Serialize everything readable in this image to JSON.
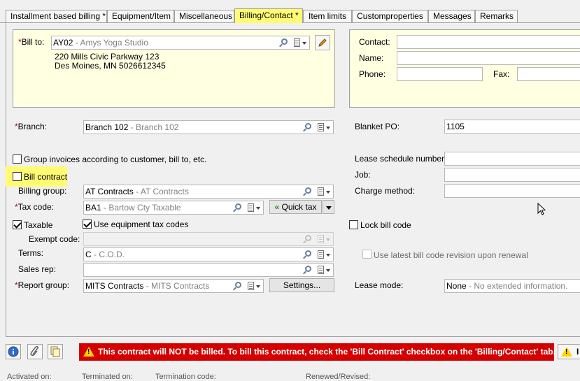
{
  "tabs": [
    {
      "label": "Installment based billing *",
      "active": false
    },
    {
      "label": "Equipment/Item",
      "active": false
    },
    {
      "label": "Miscellaneous",
      "active": false
    },
    {
      "label": "Billing/Contact *",
      "active": true
    },
    {
      "label": "Item limits",
      "active": false
    },
    {
      "label": "Customproperties",
      "active": false
    },
    {
      "label": "Messages",
      "active": false
    },
    {
      "label": "Remarks",
      "active": false
    }
  ],
  "bill_to": {
    "label": "Bill to:",
    "code": "AY02",
    "name": " - Amys Yoga Studio",
    "address_line1": "220 Mills Civic Parkway 123",
    "address_line2": "Des Moines, MN 5026612345"
  },
  "contact": {
    "contact_label": "Contact:",
    "name_label": "Name:",
    "phone_label": "Phone:",
    "fax_label": "Fax:"
  },
  "branch": {
    "label": "Branch:",
    "code": "Branch 102",
    "desc": " - Branch 102"
  },
  "blanket_po": {
    "label": "Blanket PO:",
    "value": "1105"
  },
  "group_invoices": {
    "label": "Group invoices according to customer, bill to, etc.",
    "checked": false
  },
  "bill_contract": {
    "label": "Bill contract",
    "checked": false
  },
  "lease_schedule": {
    "label": "Lease schedule number:"
  },
  "job": {
    "label": "Job:"
  },
  "charge_method": {
    "label": "Charge method:"
  },
  "billing_group": {
    "label": "Billing group:",
    "code": "AT Contracts",
    "desc": " - AT Contracts"
  },
  "tax_code": {
    "label": "Tax code:",
    "code": "BA1",
    "desc": " - Bartow Cty Taxable",
    "quick_tax_label": "Quick tax"
  },
  "taxable": {
    "label": "Taxable",
    "checked": true
  },
  "use_equipment_tax": {
    "label": "Use equipment tax codes",
    "checked": true
  },
  "lock_bill_code": {
    "label": "Lock bill code",
    "checked": false
  },
  "exempt_code": {
    "label": "Exempt code:"
  },
  "terms": {
    "label": "Terms:",
    "code": "C",
    "desc": " - C.O.D."
  },
  "latest_bill_code": {
    "label": "Use latest bill code revision upon renewal",
    "checked": false
  },
  "sales_rep": {
    "label": "Sales rep:"
  },
  "report_group": {
    "label": "Report group:",
    "code": "MITS Contracts",
    "desc": " - MITS Contracts",
    "settings_label": "Settings..."
  },
  "lease_mode": {
    "label": "Lease mode:",
    "code": "None",
    "desc": " - No extended information."
  },
  "banner": {
    "message": "This contract will NOT be billed.  To bill this contract, check the 'Bill Contract' checkbox on the 'Billing/Contact' tab.",
    "color": "#d40000"
  },
  "footer": {
    "activated": "Activated on:",
    "terminated": "Terminated on:",
    "termination_code": "Termination code:",
    "renewed": "Renewed/Revised:"
  },
  "colors": {
    "highlight": "#fffb73",
    "box_bg": "#ffffe1",
    "required": "#c00000"
  }
}
